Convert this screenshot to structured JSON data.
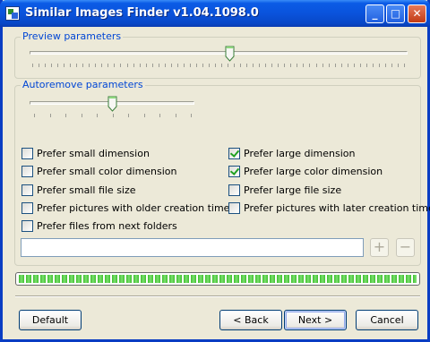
{
  "window": {
    "title": "Similar Images Finder v1.04.1098.0"
  },
  "title_buttons": {
    "minimize": "_",
    "maximize": "□",
    "close": "✕"
  },
  "preview_group": {
    "legend": "Preview parameters",
    "slider_value": 0.53,
    "tick_count": 60
  },
  "autoremove_group": {
    "legend": "Autoremove parameters",
    "slider_value": 0.5,
    "tick_count": 11
  },
  "options_left": [
    {
      "label": "Prefer small dimension",
      "checked": false
    },
    {
      "label": "Prefer small color dimension",
      "checked": false
    },
    {
      "label": "Prefer small file size",
      "checked": false
    },
    {
      "label": "Prefer pictures with older creation time",
      "checked": false
    },
    {
      "label": "Prefer files from next folders",
      "checked": false
    }
  ],
  "options_right": [
    {
      "label": "Prefer large dimension",
      "checked": true
    },
    {
      "label": "Prefer large color dimension",
      "checked": true
    },
    {
      "label": "Prefer large file size",
      "checked": false
    },
    {
      "label": "Prefer pictures with later creation time",
      "checked": false
    }
  ],
  "folder": {
    "value": "",
    "add_label": "+",
    "remove_label": "−"
  },
  "progress": {
    "value": 1.0
  },
  "buttons": {
    "default": "Default",
    "back": "< Back",
    "next": "Next >",
    "cancel": "Cancel"
  },
  "colors": {
    "title_bar": "#0A53DC",
    "legend_text": "#0046D5",
    "progress": "#3DBE2D",
    "check": "#21A121"
  }
}
